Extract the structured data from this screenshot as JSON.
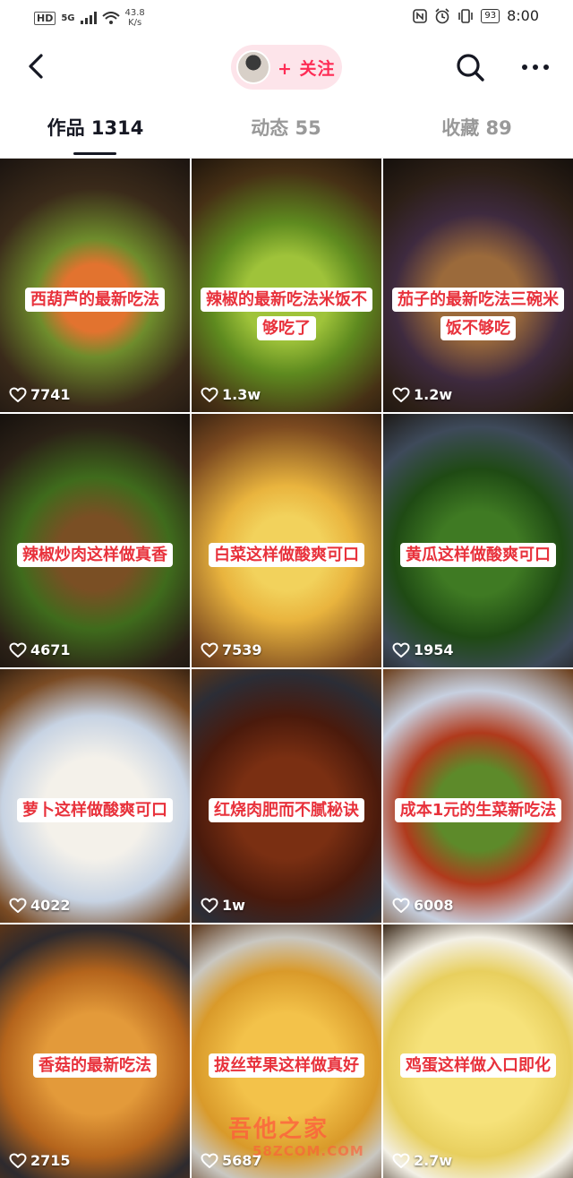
{
  "status_bar": {
    "hd": "HD",
    "network": "5G",
    "speed_value": "43.8",
    "speed_unit": "K/s",
    "battery": "93",
    "time": "8:00"
  },
  "nav": {
    "follow_label": "+ 关注"
  },
  "tabs": [
    {
      "label": "作品 1314",
      "active": true
    },
    {
      "label": "动态 55",
      "active": false
    },
    {
      "label": "收藏 89",
      "active": false
    }
  ],
  "videos": [
    {
      "caption": "西葫芦的最新吃法",
      "likes": "7741"
    },
    {
      "caption": "辣椒的最新吃法米饭不够吃了",
      "likes": "1.3w"
    },
    {
      "caption": "茄子的最新吃法三碗米饭不够吃",
      "likes": "1.2w"
    },
    {
      "caption": "辣椒炒肉这样做真香",
      "likes": "4671"
    },
    {
      "caption": "白菜这样做酸爽可口",
      "likes": "7539"
    },
    {
      "caption": "黄瓜这样做酸爽可口",
      "likes": "1954"
    },
    {
      "caption": "萝卜这样做酸爽可口",
      "likes": "4022"
    },
    {
      "caption": "红烧肉肥而不腻秘诀",
      "likes": "1w"
    },
    {
      "caption": "成本1元的生菜新吃法",
      "likes": "6008"
    },
    {
      "caption": "香菇的最新吃法",
      "likes": "2715"
    },
    {
      "caption": "拔丝苹果这样做真好",
      "likes": "5687"
    },
    {
      "caption": "鸡蛋这样做入口即化",
      "likes": "2.7w"
    }
  ],
  "watermark": {
    "line1": "吾他之家",
    "line2": "58ZCOM.COM"
  },
  "colors": {
    "accent": "#fe2c55",
    "caption_text": "#e8323c"
  }
}
